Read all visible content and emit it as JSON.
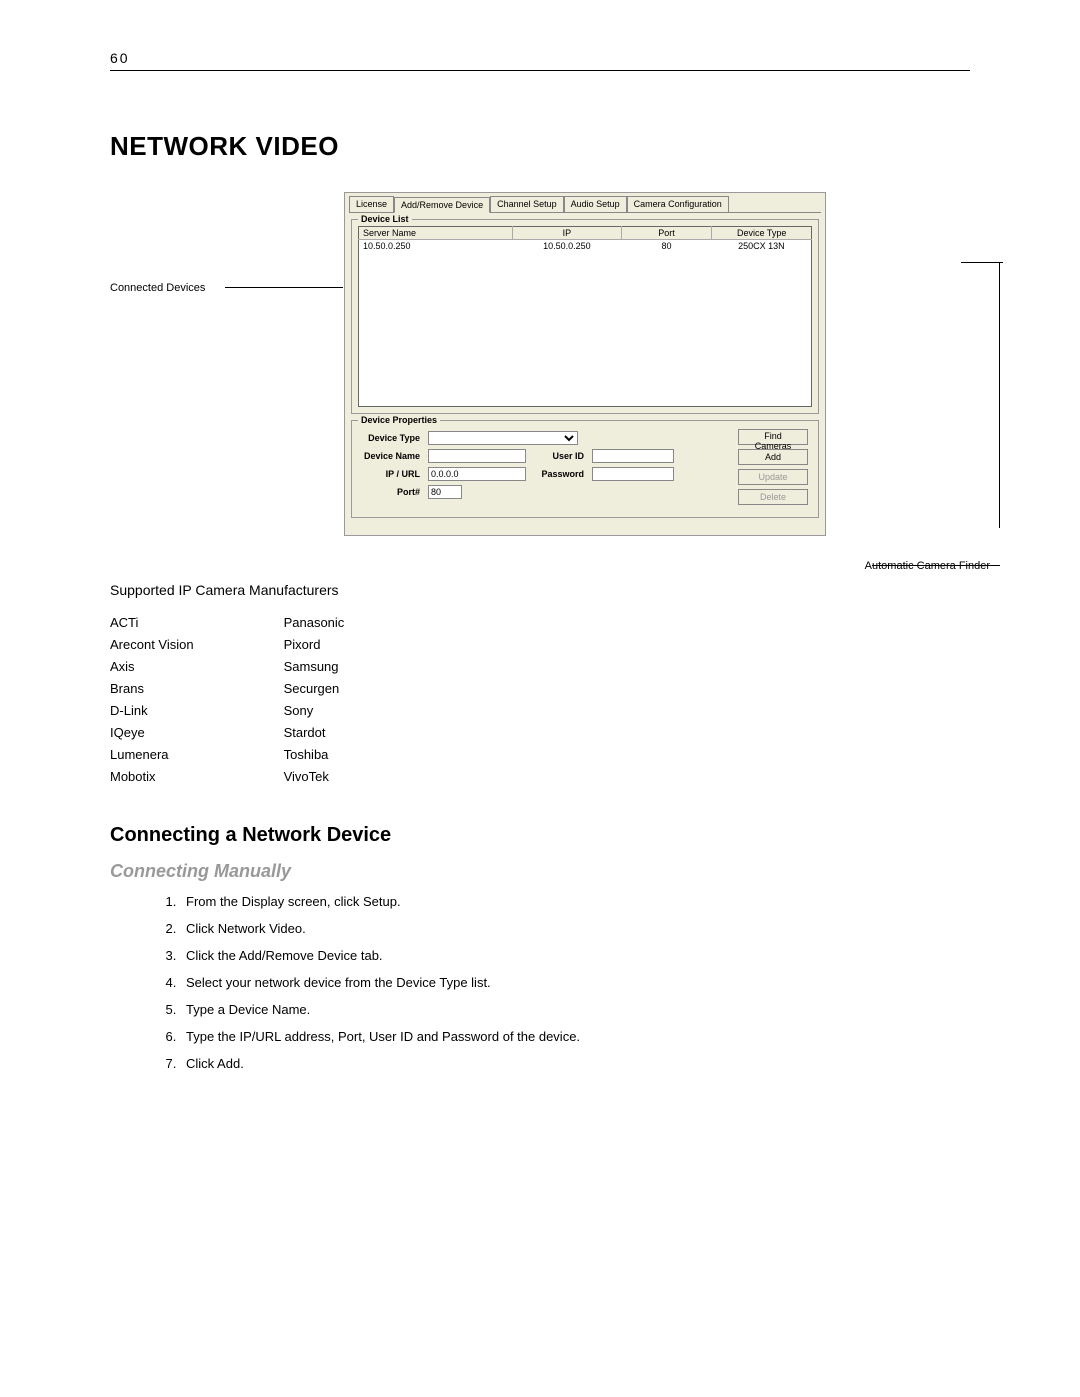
{
  "page_number": "60",
  "title": "NETWORK VIDEO",
  "callouts": {
    "left": "Connected Devices",
    "right": "Automatic Camera Finder"
  },
  "tabs": [
    "License",
    "Add/Remove Device",
    "Channel Setup",
    "Audio Setup",
    "Camera Configuration"
  ],
  "device_list": {
    "group": "Device List",
    "headers": [
      "Server Name",
      "IP",
      "Port",
      "Device Type"
    ],
    "row": {
      "server": "10.50.0.250",
      "ip": "10.50.0.250",
      "port": "80",
      "type": "250CX 13N"
    }
  },
  "device_props": {
    "group": "Device Properties",
    "labels": {
      "type": "Device Type",
      "name": "Device Name",
      "ipurl": "IP / URL",
      "port": "Port#",
      "user": "User ID",
      "pwd": "Password"
    },
    "values": {
      "ipurl": "0.0.0.0",
      "port": "80"
    },
    "buttons": {
      "find": "Find Cameras",
      "add": "Add",
      "update": "Update",
      "delete": "Delete"
    }
  },
  "supported_heading": "Supported IP Camera Manufacturers",
  "manufacturers": {
    "col1": [
      "ACTi",
      "Arecont Vision",
      "Axis",
      "Brans",
      "D-Link",
      "IQeye",
      "Lumenera",
      "Mobotix"
    ],
    "col2": [
      "Panasonic",
      "Pixord",
      "Samsung",
      "Securgen",
      "Sony",
      "Stardot",
      "Toshiba",
      "VivoTek"
    ]
  },
  "sub1": "Connecting a Network Device",
  "sub2": "Connecting Manually",
  "steps": [
    "From the Display screen, click Setup.",
    "Click Network Video.",
    "Click the Add/Remove Device tab.",
    "Select your network device from the Device Type list.",
    "Type a Device Name.",
    "Type the IP/URL address, Port, User ID and Password of the device.",
    "Click Add."
  ]
}
